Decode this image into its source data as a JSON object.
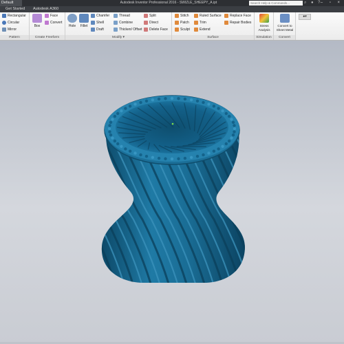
{
  "titlebar": {
    "file_tab": "Default",
    "title": "Autodesk Inventor Professional 2016 - SWIZLE_SHEEPY_A.ipt",
    "search_placeholder": "Search Help & Commands...",
    "window_buttons": "– ▫ ×"
  },
  "tabs": [
    "Get Started",
    "Autodesk A360"
  ],
  "ribbon": {
    "pattern": {
      "label": "Pattern",
      "items": [
        "Rectangular",
        "Circular",
        "Mirror"
      ]
    },
    "create_freeform": {
      "label": "Create Freeform",
      "box": "Box",
      "items": [
        "Face",
        "Convert"
      ]
    },
    "modify": {
      "label": "Modify",
      "large": [
        "Hole",
        "Fillet"
      ],
      "col1": [
        "Chamfer",
        "Shell",
        "Draft"
      ],
      "col2": [
        "Thread",
        "Combine",
        "Thicken/ Offset"
      ],
      "col3": [
        "Split",
        "Direct",
        "Delete Face"
      ]
    },
    "surface": {
      "label": "Surface",
      "col1": [
        "Stitch",
        "Patch",
        "Sculpt"
      ],
      "col2": [
        "Ruled Surface",
        "Trim",
        "Extend"
      ],
      "col3": [
        "Replace Face",
        "Repair Bodies"
      ]
    },
    "simulation": {
      "label": "Simulation",
      "button": "Stress Analysis"
    },
    "convert": {
      "label": "Convert",
      "button": "Convert to Sheet Metal"
    }
  },
  "colors": {
    "vase": "#1c6f97",
    "vase_dark": "#0f4d6c",
    "vase_light": "#3a8fb6"
  }
}
